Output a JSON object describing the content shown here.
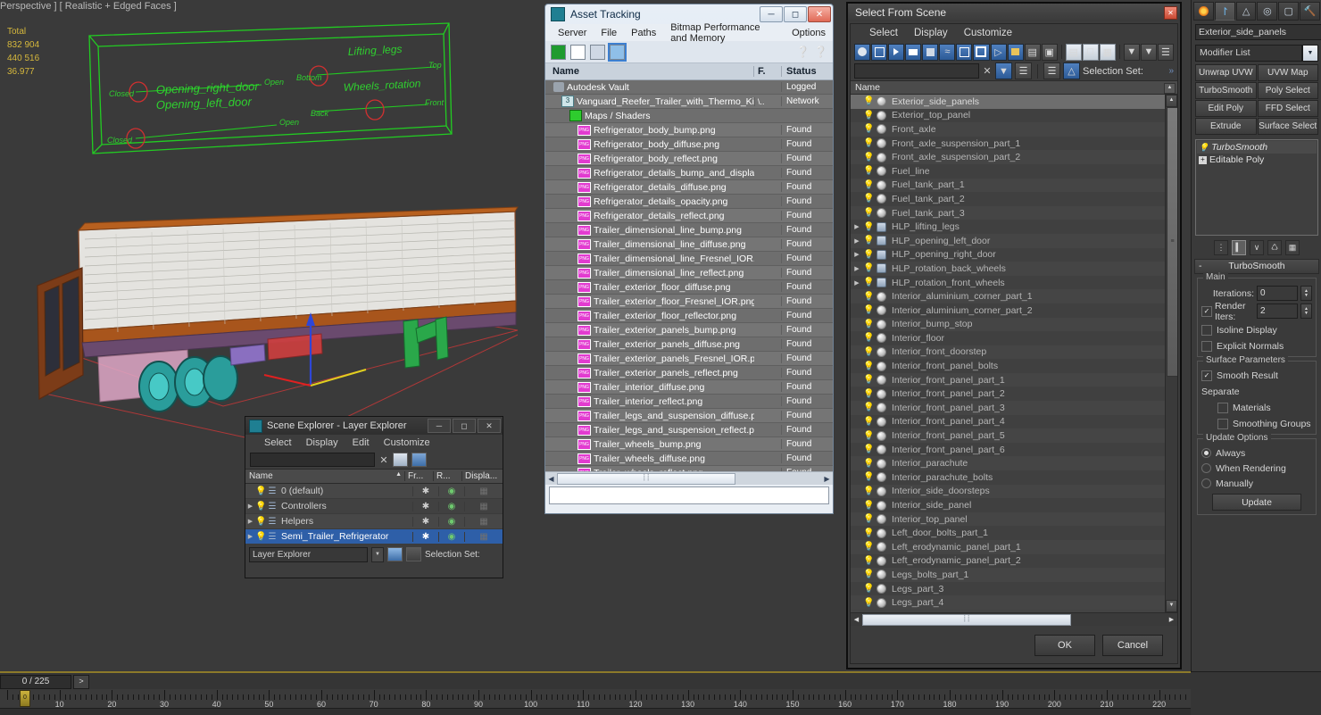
{
  "viewport": {
    "label": "Perspective ] [ Realistic + Edged Faces ]",
    "stats": {
      "header": "Total",
      "verts": "832 904",
      "faces": "440 516",
      "fps": "36.977"
    },
    "helpers": [
      {
        "name": "Opening_right_door",
        "from": "Closed",
        "to": "Open"
      },
      {
        "name": "Opening_left_door",
        "from": "Closed",
        "to": "Open"
      },
      {
        "name": "Lifting_legs",
        "from": "Bottom",
        "to": "Top"
      },
      {
        "name": "Wheels_rotation",
        "from": "Back",
        "to": "Front"
      }
    ]
  },
  "asset_tracking": {
    "title": "Asset Tracking",
    "menu": [
      "Server",
      "File",
      "Paths",
      "Bitmap Performance and Memory",
      "Options"
    ],
    "toolbar_icons": [
      "refresh-icon",
      "list-icon",
      "thumbnail-icon",
      "grid-icon",
      "help-icon",
      "help-alt-icon"
    ],
    "columns": [
      "Name",
      "F.",
      "Status"
    ],
    "rows": [
      {
        "name": "Autodesk Vault",
        "icon": "vault-icon",
        "indent": 1,
        "f": "",
        "status": "Logged"
      },
      {
        "name": "Vanguard_Reefer_Trailer_with_Thermo_King_C...",
        "icon": "max-file-icon",
        "indent": 2,
        "f": "\\..",
        "status": "Network"
      },
      {
        "name": "Maps / Shaders",
        "icon": "maps-shaders-icon",
        "indent": 3,
        "f": "",
        "status": ""
      },
      {
        "name": "Refrigerator_body_bump.png",
        "icon": "png-icon",
        "indent": 4,
        "f": "",
        "status": "Found"
      },
      {
        "name": "Refrigerator_body_diffuse.png",
        "icon": "png-icon",
        "indent": 4,
        "f": "",
        "status": "Found"
      },
      {
        "name": "Refrigerator_body_reflect.png",
        "icon": "png-icon",
        "indent": 4,
        "f": "",
        "status": "Found"
      },
      {
        "name": "Refrigerator_details_bump_and_displace...",
        "icon": "png-icon",
        "indent": 4,
        "f": "",
        "status": "Found"
      },
      {
        "name": "Refrigerator_details_diffuse.png",
        "icon": "png-icon",
        "indent": 4,
        "f": "",
        "status": "Found"
      },
      {
        "name": "Refrigerator_details_opacity.png",
        "icon": "png-icon",
        "indent": 4,
        "f": "",
        "status": "Found"
      },
      {
        "name": "Refrigerator_details_reflect.png",
        "icon": "png-icon",
        "indent": 4,
        "f": "",
        "status": "Found"
      },
      {
        "name": "Trailer_dimensional_line_bump.png",
        "icon": "png-icon",
        "indent": 4,
        "f": "",
        "status": "Found"
      },
      {
        "name": "Trailer_dimensional_line_diffuse.png",
        "icon": "png-icon",
        "indent": 4,
        "f": "",
        "status": "Found"
      },
      {
        "name": "Trailer_dimensional_line_Fresnel_IOR.png",
        "icon": "png-icon",
        "indent": 4,
        "f": "",
        "status": "Found"
      },
      {
        "name": "Trailer_dimensional_line_reflect.png",
        "icon": "png-icon",
        "indent": 4,
        "f": "",
        "status": "Found"
      },
      {
        "name": "Trailer_exterior_floor_diffuse.png",
        "icon": "png-icon",
        "indent": 4,
        "f": "",
        "status": "Found"
      },
      {
        "name": "Trailer_exterior_floor_Fresnel_IOR.png",
        "icon": "png-icon",
        "indent": 4,
        "f": "",
        "status": "Found"
      },
      {
        "name": "Trailer_exterior_floor_reflector.png",
        "icon": "png-icon",
        "indent": 4,
        "f": "",
        "status": "Found"
      },
      {
        "name": "Trailer_exterior_panels_bump.png",
        "icon": "png-icon",
        "indent": 4,
        "f": "",
        "status": "Found"
      },
      {
        "name": "Trailer_exterior_panels_diffuse.png",
        "icon": "png-icon",
        "indent": 4,
        "f": "",
        "status": "Found"
      },
      {
        "name": "Trailer_exterior_panels_Fresnel_IOR.png",
        "icon": "png-icon",
        "indent": 4,
        "f": "",
        "status": "Found"
      },
      {
        "name": "Trailer_exterior_panels_reflect.png",
        "icon": "png-icon",
        "indent": 4,
        "f": "",
        "status": "Found"
      },
      {
        "name": "Trailer_interior_diffuse.png",
        "icon": "png-icon",
        "indent": 4,
        "f": "",
        "status": "Found"
      },
      {
        "name": "Trailer_interior_reflect.png",
        "icon": "png-icon",
        "indent": 4,
        "f": "",
        "status": "Found"
      },
      {
        "name": "Trailer_legs_and_suspension_diffuse.png",
        "icon": "png-icon",
        "indent": 4,
        "f": "",
        "status": "Found"
      },
      {
        "name": "Trailer_legs_and_suspension_reflect.png",
        "icon": "png-icon",
        "indent": 4,
        "f": "",
        "status": "Found"
      },
      {
        "name": "Trailer_wheels_bump.png",
        "icon": "png-icon",
        "indent": 4,
        "f": "",
        "status": "Found"
      },
      {
        "name": "Trailer_wheels_diffuse.png",
        "icon": "png-icon",
        "indent": 4,
        "f": "",
        "status": "Found"
      },
      {
        "name": "Trailer_wheels_reflect.png",
        "icon": "png-icon",
        "indent": 4,
        "f": "",
        "status": "Found"
      }
    ]
  },
  "scene_explorer": {
    "title": "Scene Explorer - Layer Explorer",
    "menu": [
      "Select",
      "Display",
      "Edit",
      "Customize"
    ],
    "search_value": "",
    "columns": [
      "Name",
      "Fr...",
      "R...",
      "Displa..."
    ],
    "sort_indicator": "▲",
    "rows": [
      {
        "name": "0 (default)",
        "expandable": false,
        "selected": false
      },
      {
        "name": "Controllers",
        "expandable": true,
        "selected": false
      },
      {
        "name": "Helpers",
        "expandable": true,
        "selected": false
      },
      {
        "name": "Semi_Trailer_Refrigerator",
        "expandable": true,
        "selected": true
      }
    ],
    "mode_value": "Layer Explorer",
    "selection_set_label": "Selection Set:"
  },
  "select_from_scene": {
    "title": "Select From Scene",
    "menu": [
      "Select",
      "Display",
      "Customize"
    ],
    "filter_value": "",
    "selection_set_label": "Selection Set:",
    "column_header": "Name",
    "ok_label": "OK",
    "cancel_label": "Cancel",
    "rows": [
      {
        "name": "Exterior_side_panels",
        "type": "geometry",
        "expandable": false,
        "selected": true
      },
      {
        "name": "Exterior_top_panel",
        "type": "geometry",
        "expandable": false,
        "selected": false
      },
      {
        "name": "Front_axle",
        "type": "geometry",
        "expandable": false,
        "selected": false
      },
      {
        "name": "Front_axle_suspension_part_1",
        "type": "geometry",
        "expandable": false,
        "selected": false
      },
      {
        "name": "Front_axle_suspension_part_2",
        "type": "geometry",
        "expandable": false,
        "selected": false
      },
      {
        "name": "Fuel_line",
        "type": "geometry",
        "expandable": false,
        "selected": false
      },
      {
        "name": "Fuel_tank_part_1",
        "type": "geometry",
        "expandable": false,
        "selected": false
      },
      {
        "name": "Fuel_tank_part_2",
        "type": "geometry",
        "expandable": false,
        "selected": false
      },
      {
        "name": "Fuel_tank_part_3",
        "type": "geometry",
        "expandable": false,
        "selected": false
      },
      {
        "name": "HLP_lifting_legs",
        "type": "helper",
        "expandable": true,
        "selected": false
      },
      {
        "name": "HLP_opening_left_door",
        "type": "helper",
        "expandable": true,
        "selected": false
      },
      {
        "name": "HLP_opening_right_door",
        "type": "helper",
        "expandable": true,
        "selected": false
      },
      {
        "name": "HLP_rotation_back_wheels",
        "type": "helper",
        "expandable": true,
        "selected": false
      },
      {
        "name": "HLP_rotation_front_wheels",
        "type": "helper",
        "expandable": true,
        "selected": false
      },
      {
        "name": "Interior_aluminium_corner_part_1",
        "type": "geometry",
        "expandable": false,
        "selected": false
      },
      {
        "name": "Interior_aluminium_corner_part_2",
        "type": "geometry",
        "expandable": false,
        "selected": false
      },
      {
        "name": "Interior_bump_stop",
        "type": "geometry",
        "expandable": false,
        "selected": false
      },
      {
        "name": "Interior_floor",
        "type": "geometry",
        "expandable": false,
        "selected": false
      },
      {
        "name": "Interior_front_doorstep",
        "type": "geometry",
        "expandable": false,
        "selected": false
      },
      {
        "name": "Interior_front_panel_bolts",
        "type": "geometry",
        "expandable": false,
        "selected": false
      },
      {
        "name": "Interior_front_panel_part_1",
        "type": "geometry",
        "expandable": false,
        "selected": false
      },
      {
        "name": "Interior_front_panel_part_2",
        "type": "geometry",
        "expandable": false,
        "selected": false
      },
      {
        "name": "Interior_front_panel_part_3",
        "type": "geometry",
        "expandable": false,
        "selected": false
      },
      {
        "name": "Interior_front_panel_part_4",
        "type": "geometry",
        "expandable": false,
        "selected": false
      },
      {
        "name": "Interior_front_panel_part_5",
        "type": "geometry",
        "expandable": false,
        "selected": false
      },
      {
        "name": "Interior_front_panel_part_6",
        "type": "geometry",
        "expandable": false,
        "selected": false
      },
      {
        "name": "Interior_parachute",
        "type": "geometry",
        "expandable": false,
        "selected": false
      },
      {
        "name": "Interior_parachute_bolts",
        "type": "geometry",
        "expandable": false,
        "selected": false
      },
      {
        "name": "Interior_side_doorsteps",
        "type": "geometry",
        "expandable": false,
        "selected": false
      },
      {
        "name": "Interior_side_panel",
        "type": "geometry",
        "expandable": false,
        "selected": false
      },
      {
        "name": "Interior_top_panel",
        "type": "geometry",
        "expandable": false,
        "selected": false
      },
      {
        "name": "Left_door_bolts_part_1",
        "type": "geometry",
        "expandable": false,
        "selected": false
      },
      {
        "name": "Left_erodynamic_panel_part_1",
        "type": "geometry",
        "expandable": false,
        "selected": false
      },
      {
        "name": "Left_erodynamic_panel_part_2",
        "type": "geometry",
        "expandable": false,
        "selected": false
      },
      {
        "name": "Legs_bolts_part_1",
        "type": "geometry",
        "expandable": false,
        "selected": false
      },
      {
        "name": "Legs_part_3",
        "type": "geometry",
        "expandable": false,
        "selected": false
      },
      {
        "name": "Legs_part_4",
        "type": "geometry",
        "expandable": false,
        "selected": false
      }
    ]
  },
  "command_panel": {
    "tabs": [
      "create-tab-icon",
      "modify-tab-icon",
      "hierarchy-tab-icon",
      "motion-tab-icon",
      "display-tab-icon",
      "utilities-tab-icon"
    ],
    "object_name": "Exterior_side_panels",
    "object_color": "#d98f28",
    "modifier_list_label": "Modifier List",
    "modifier_buttons": [
      "Unwrap UVW",
      "UVW Map",
      "TurboSmooth",
      "Poly Select",
      "Edit Poly",
      "FFD Select",
      "Extrude",
      "Surface Select"
    ],
    "stack": [
      {
        "label": "TurboSmooth",
        "active": true
      },
      {
        "label": "Editable Poly",
        "active": false
      }
    ],
    "rollout": {
      "title": "TurboSmooth",
      "main_group": "Main",
      "iterations_label": "Iterations:",
      "iterations_value": "0",
      "render_iters_label": "Render Iters:",
      "render_iters_value": "2",
      "render_iters_checked": true,
      "isoline_label": "Isoline Display",
      "isoline_checked": false,
      "explicit_normals_label": "Explicit Normals",
      "explicit_normals_checked": false,
      "surface_group": "Surface Parameters",
      "smooth_result_label": "Smooth Result",
      "smooth_result_checked": true,
      "separate_label": "Separate",
      "materials_label": "Materials",
      "materials_checked": false,
      "smoothing_groups_label": "Smoothing Groups",
      "smoothing_groups_checked": false,
      "update_group": "Update Options",
      "update_options": [
        {
          "label": "Always",
          "selected": true
        },
        {
          "label": "When Rendering",
          "selected": false
        },
        {
          "label": "Manually",
          "selected": false
        }
      ],
      "update_button": "Update"
    }
  },
  "timeline": {
    "current_frame_display": "0 / 225",
    "next_key_label": ">",
    "tick_labels": [
      "10",
      "20",
      "30",
      "40",
      "50",
      "60",
      "70",
      "80",
      "90",
      "100",
      "110",
      "120",
      "130",
      "140",
      "150",
      "160",
      "170",
      "180",
      "190",
      "200",
      "210",
      "220"
    ],
    "frame_start": 0,
    "frame_end": 225
  }
}
